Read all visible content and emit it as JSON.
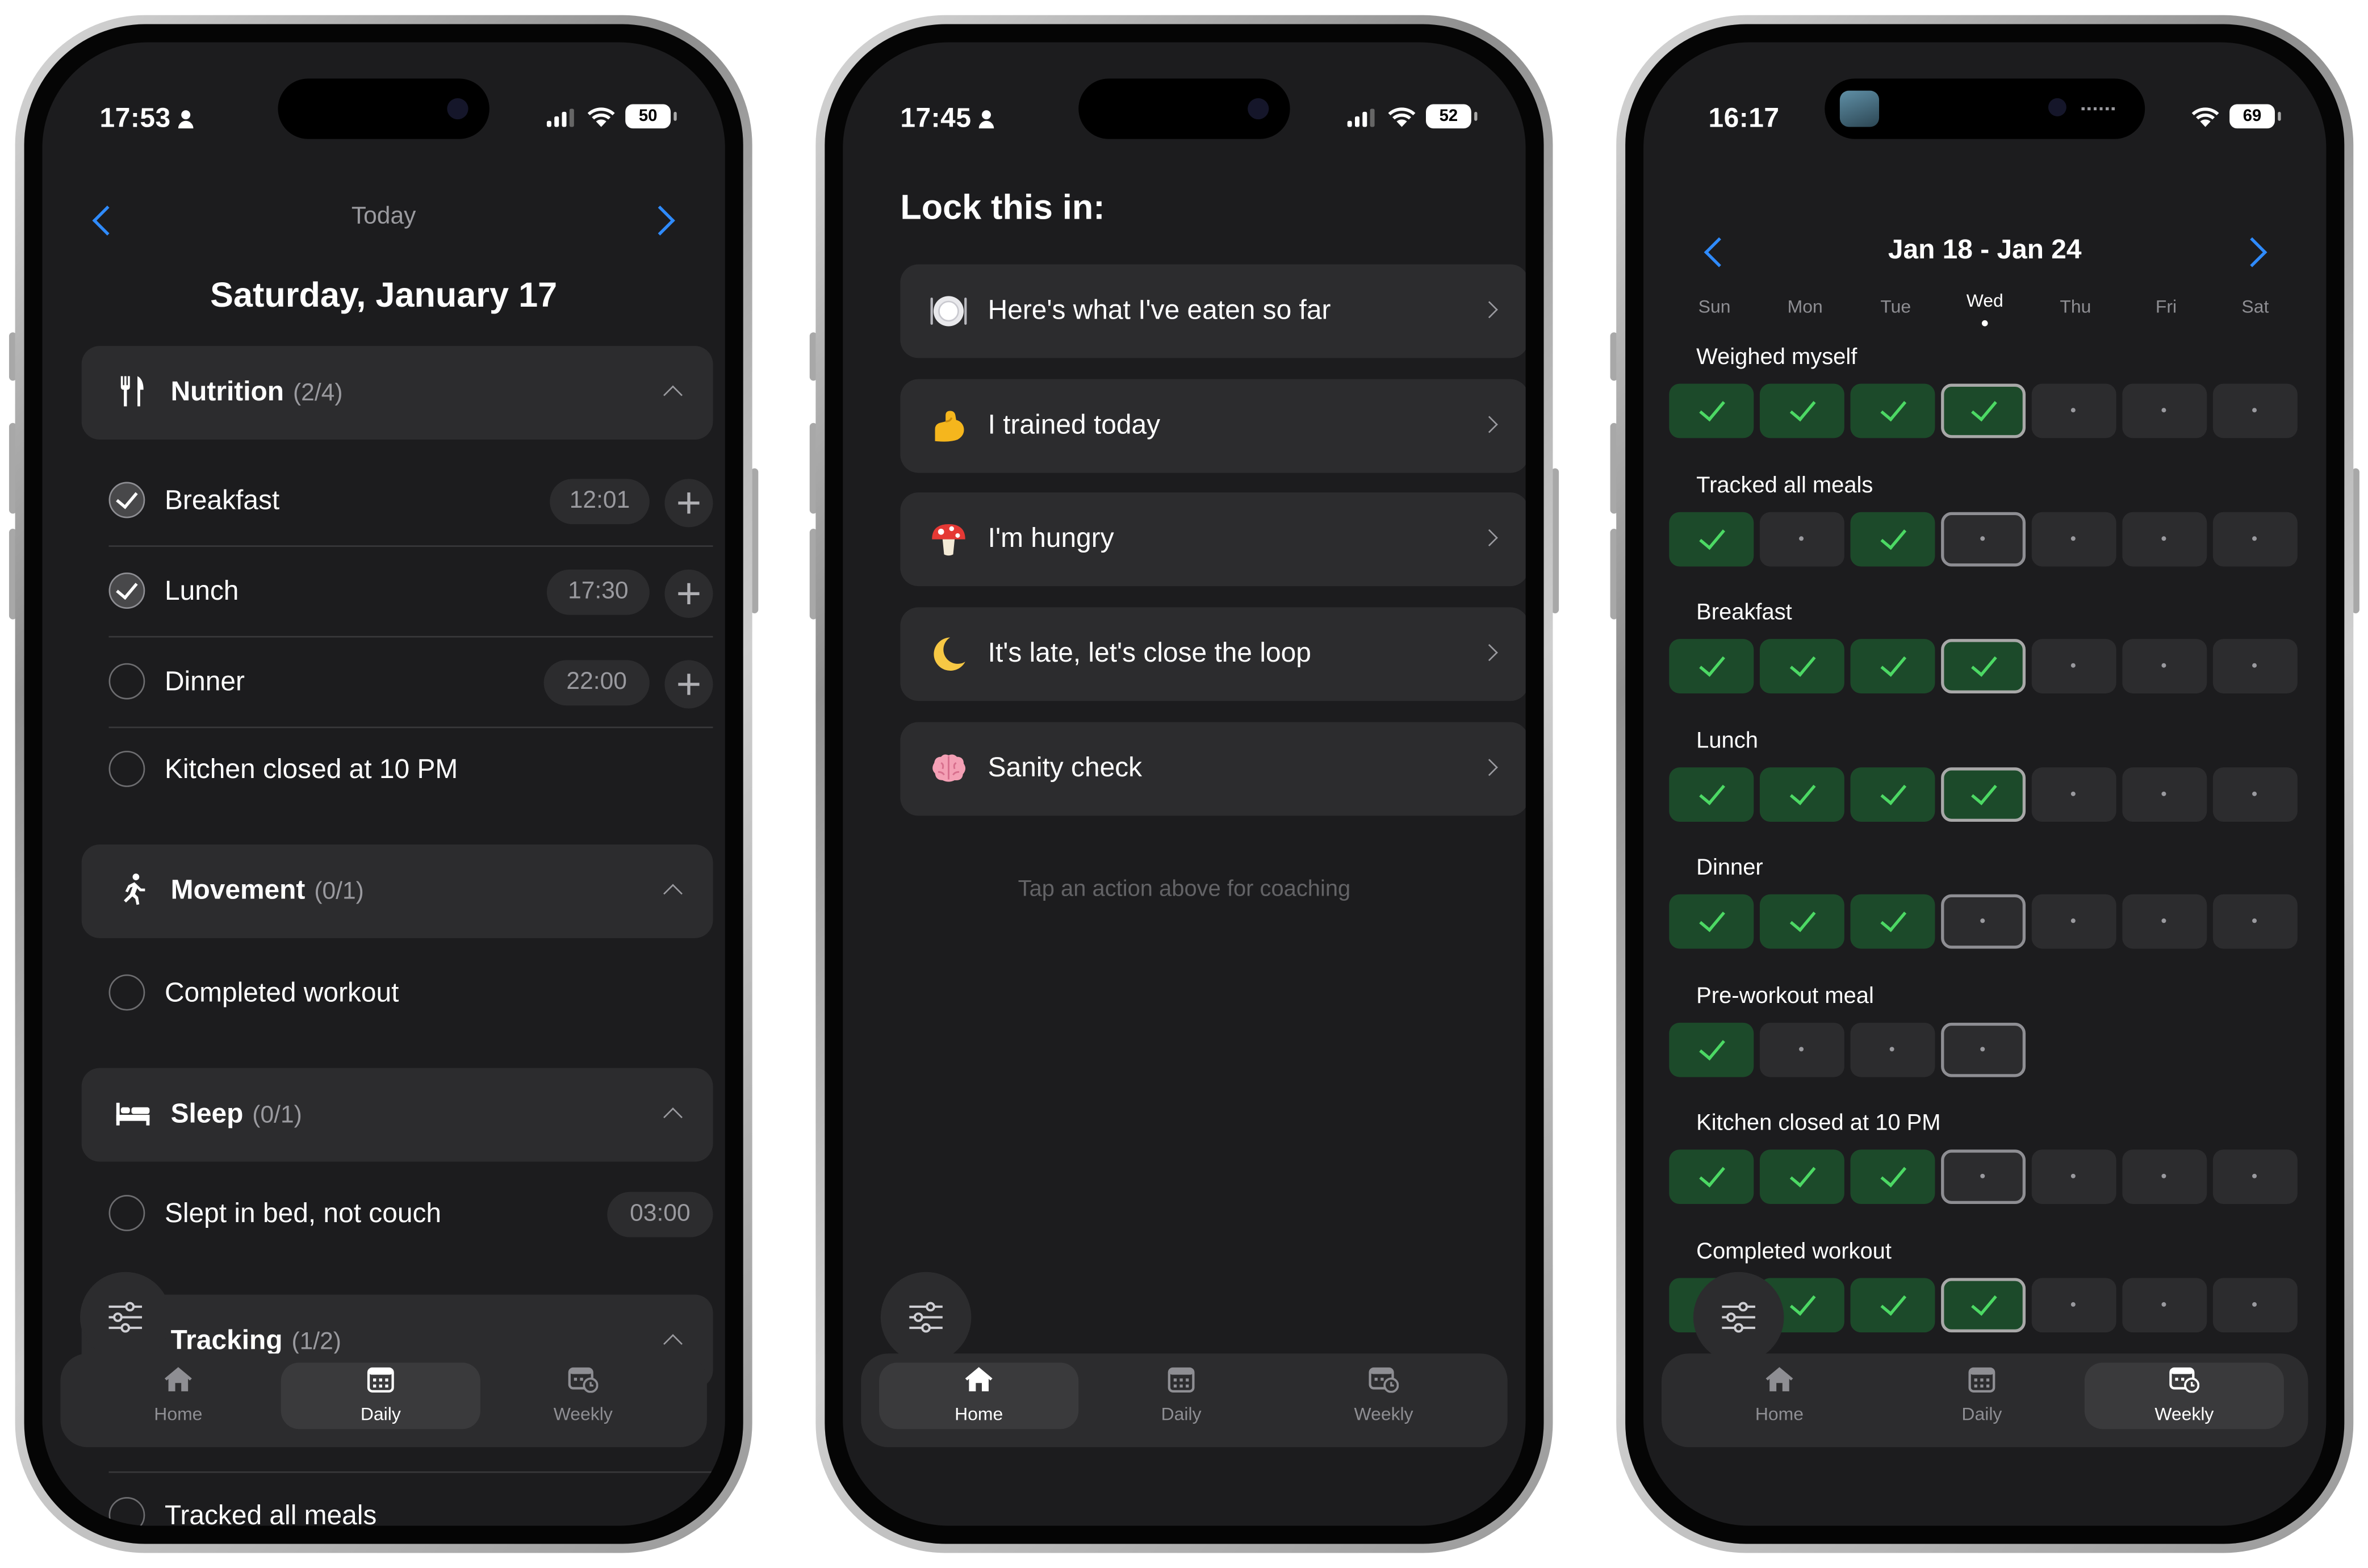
{
  "phone1": {
    "status": {
      "time": "17:53",
      "battery": "50"
    },
    "nav": {
      "label": "Today"
    },
    "date": "Saturday, January 17",
    "sections": [
      {
        "name": "Nutrition",
        "count": "(2/4)"
      },
      {
        "name": "Movement",
        "count": "(0/1)"
      },
      {
        "name": "Sleep",
        "count": "(0/1)"
      },
      {
        "name": "Tracking",
        "count": "(1/2)"
      }
    ],
    "items": [
      {
        "label": "Breakfast",
        "time": "12:01",
        "checked": true
      },
      {
        "label": "Lunch",
        "time": "17:30",
        "checked": true
      },
      {
        "label": "Dinner",
        "time": "22:00",
        "checked": false
      },
      {
        "label": "Kitchen closed at 10 PM",
        "checked": false
      },
      {
        "label": "Completed workout",
        "checked": false
      },
      {
        "label": "Slept in bed, not couch",
        "time": "03:00",
        "checked": false
      },
      {
        "label": "Tracked all meals",
        "checked": false
      }
    ]
  },
  "phone2": {
    "status": {
      "time": "17:45",
      "battery": "52"
    },
    "heading": "Lock this in:",
    "actions": [
      {
        "label": "Here's what I've eaten so far",
        "icon": "plate-icon"
      },
      {
        "label": "I trained today",
        "icon": "flexed-arm-icon"
      },
      {
        "label": "I'm hungry",
        "icon": "mushroom-icon"
      },
      {
        "label": "It's late, let's close the loop",
        "icon": "moon-icon"
      },
      {
        "label": "Sanity check",
        "icon": "brain-icon"
      }
    ],
    "hint": "Tap an action above for coaching"
  },
  "phone3": {
    "status": {
      "time": "16:17",
      "battery": "69"
    },
    "week": "Jan 18 - Jan 24",
    "days": [
      "Sun",
      "Mon",
      "Tue",
      "Wed",
      "Thu",
      "Fri",
      "Sat"
    ],
    "current_day": "Wed",
    "habits": [
      {
        "name": "Weighed myself",
        "days": [
          "done",
          "done",
          "done",
          "done",
          "pending",
          "pending",
          "pending"
        ]
      },
      {
        "name": "Tracked all meals",
        "days": [
          "done",
          "pending",
          "done",
          "pending",
          "pending",
          "pending",
          "pending"
        ]
      },
      {
        "name": "Breakfast",
        "days": [
          "done",
          "done",
          "done",
          "done",
          "pending",
          "pending",
          "pending"
        ]
      },
      {
        "name": "Lunch",
        "days": [
          "done",
          "done",
          "done",
          "done",
          "pending",
          "pending",
          "pending"
        ]
      },
      {
        "name": "Dinner",
        "days": [
          "done",
          "done",
          "done",
          "pending",
          "pending",
          "pending",
          "pending"
        ]
      },
      {
        "name": "Pre-workout meal",
        "days": [
          "done",
          "pending",
          "pending",
          "pending",
          "none",
          "none",
          "none"
        ]
      },
      {
        "name": "Kitchen closed at 10 PM",
        "days": [
          "done",
          "done",
          "done",
          "pending",
          "pending",
          "pending",
          "pending"
        ]
      },
      {
        "name": "Completed workout",
        "days": [
          "done",
          "done",
          "done",
          "done",
          "pending",
          "pending",
          "pending"
        ]
      }
    ]
  },
  "tabs": [
    "Home",
    "Daily",
    "Weekly"
  ],
  "colors": {
    "accent": "#2f8bff",
    "done": "#4cd964",
    "card": "#2c2c2e",
    "background": "#1c1c1e"
  }
}
